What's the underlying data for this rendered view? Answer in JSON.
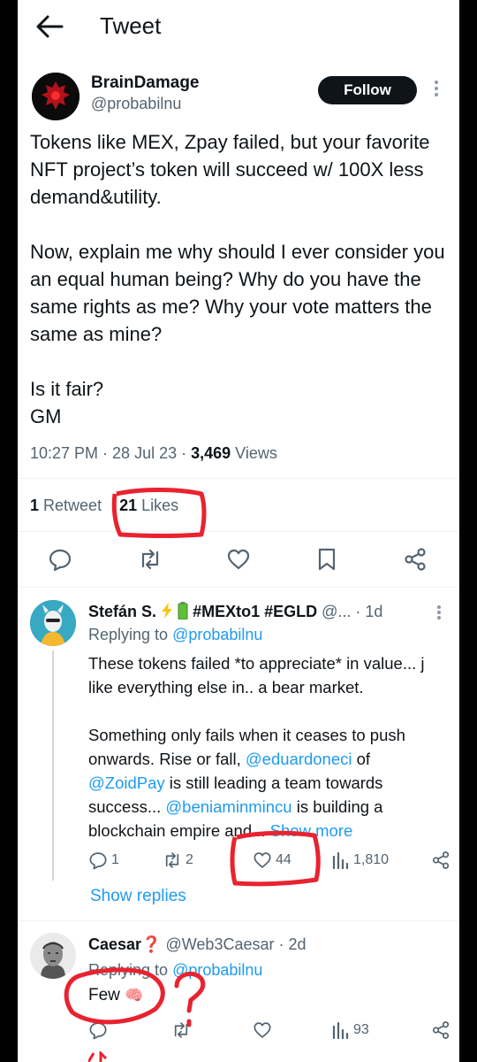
{
  "header": {
    "title": "Tweet"
  },
  "tweet": {
    "author_name": "BrainDamage",
    "author_handle": "@probabilnu",
    "follow_label": "Follow",
    "paragraphs": [
      "Tokens like MEX, Zpay  failed, but your favorite NFT project’s token will succeed w/ 100X less demand&utility.",
      "Now, explain me why should I ever consider you an equal human being? Why do you have the same rights as me? Why your vote matters the same as mine?",
      "Is it fair?\nGM"
    ],
    "time": "10:27 PM",
    "date": "28 Jul 23",
    "views_count": "3,469",
    "views_label": "Views",
    "retweets_count": "1",
    "retweets_label": "Retweet",
    "likes_count": "21",
    "likes_label": "Likes"
  },
  "reply1": {
    "author_name": "Stefán S.",
    "author_extra": "#MEXto1 #EGLD",
    "handle_truncated": "@...",
    "age": "1d",
    "replying_prefix": "Replying to",
    "replying_to": "@probabilnu",
    "text_p1": "These tokens failed *to appreciate* in value... j like everything else in.. a bear market.",
    "text_p2_a": "Something only fails when it ceases to push onwards. Rise or fall, ",
    "mention1": "@eduardoneci",
    "text_p2_b": " of ",
    "mention2": "@ZoidPay",
    "text_p2_c": " is still leading a team towards success... ",
    "mention3": "@beniaminmincu",
    "text_p2_d": " is building a blockchain empire and... ",
    "show_more": "Show more",
    "replies": "1",
    "retweets": "2",
    "likes": "44",
    "views": "1,810",
    "show_replies": "Show replies"
  },
  "reply2": {
    "author_name": "Caesar",
    "author_emoji": "❓",
    "author_handle": "@Web3Caesar",
    "age": "2d",
    "replying_prefix": "Replying to",
    "replying_to": "@probabilnu",
    "text": "Few",
    "text_emoji": "🧠",
    "views": "93"
  },
  "colors": {
    "accent": "#1d9bf0",
    "muted": "#536471",
    "annotation": "#e8232f"
  }
}
